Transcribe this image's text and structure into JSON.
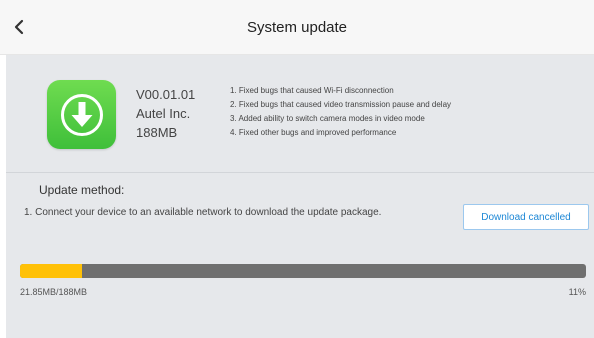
{
  "header": {
    "title": "System update",
    "back_icon": "chevron-left-icon"
  },
  "update": {
    "icon": "download-arrow-icon",
    "icon_color": "#4cc942",
    "version": "V00.01.01",
    "vendor": "Autel Inc.",
    "size": "188MB",
    "release_notes": [
      "1. Fixed bugs that caused Wi-Fi disconnection",
      "2. Fixed bugs that caused video transmission pause and delay",
      "3. Added ability to switch camera modes in video mode",
      "4. Fixed other bugs and improved performance"
    ]
  },
  "method": {
    "label": "Update method:",
    "step": "1. Connect your device to an available network to download the update package.",
    "button_label": "Download cancelled",
    "button_color": "#1e88d6"
  },
  "progress": {
    "downloaded_text": "21.85MB/188MB",
    "percent_text": "11%",
    "fraction": 0.11,
    "fill_color": "#ffc107",
    "track_color": "#6f6f6f"
  }
}
